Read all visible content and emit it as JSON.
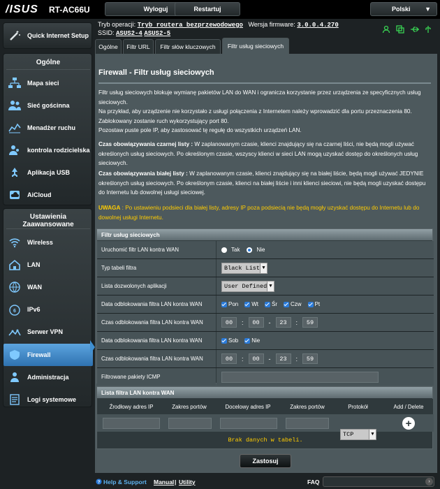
{
  "header": {
    "logo": "/ISUS",
    "model": "RT-AC66U",
    "logout_label": "Wyloguj",
    "restart_label": "Restartuj",
    "language": "Polski"
  },
  "info": {
    "mode_label": "Tryb operacji:",
    "mode_value": "Tryb routera bezprzewodowego",
    "firmware_label": "Wersja firmware:",
    "firmware_value": "3.0.0.4.270",
    "ssid_label": "SSID:",
    "ssid1": "ASUS2-4",
    "ssid2": "ASUS2-5"
  },
  "sidebar": {
    "quick": "Quick Internet Setup",
    "general_heading": "Ogólne",
    "general_items": [
      {
        "label": "Mapa sieci",
        "icon": "network-map-icon"
      },
      {
        "label": "Sieć gościnna",
        "icon": "guest-network-icon"
      },
      {
        "label": "Menadżer ruchu",
        "icon": "traffic-manager-icon"
      },
      {
        "label": "kontrola rodzicielska",
        "icon": "parental-control-icon"
      },
      {
        "label": "Aplikacja USB",
        "icon": "usb-icon"
      },
      {
        "label": "AiCloud",
        "icon": "aicloud-icon"
      }
    ],
    "advanced_heading": "Ustawienia Zaawansowane",
    "advanced_items": [
      {
        "label": "Wireless",
        "icon": "wireless-icon"
      },
      {
        "label": "LAN",
        "icon": "lan-icon"
      },
      {
        "label": "WAN",
        "icon": "wan-icon"
      },
      {
        "label": "IPv6",
        "icon": "ipv6-icon"
      },
      {
        "label": "Serwer VPN",
        "icon": "vpn-icon"
      },
      {
        "label": "Firewall",
        "icon": "firewall-icon",
        "active": true
      },
      {
        "label": "Administracja",
        "icon": "admin-icon"
      },
      {
        "label": "Logi systemowe",
        "icon": "system-log-icon"
      }
    ]
  },
  "tabs": [
    "Ogólne",
    "Filtr URL",
    "Filtr słów kluczowych",
    "Filtr usług sieciowych"
  ],
  "page": {
    "title": "Firewall - Filtr usług sieciowych",
    "p1": "Filtr usług sieciowych blokuje wymianę pakietów LAN do WAN i ogranicza korzystanie przez urządzenia ze specyficznych usług sieciowych.",
    "p2": "Na przykład, aby urządzenie nie korzystało z usługi połączenia z Internetem należy wprowadzić dla portu przeznaczenia 80. Zablokowany zostanie ruch wykorzystujący port 80.",
    "p3": "Pozostaw puste pole IP, aby zastosować tę regułę do wszystkich urządzeń LAN.",
    "black_bold": "Czas obowiązywania czarnej listy :",
    "black_text": " W zaplanowanym czasie, klienci znajdujący się na czarnej liści, nie będą mogli używać określonych usług sieciowych. Po określonym czasie, wszyscy klienci w sieci LAN mogą uzyskać dostęp do określonych usług sieciowych.",
    "white_bold": "Czas obowiązywania białej listy :",
    "white_text": " W zaplanowanym czasie, klienci znajdujący się na białej liście, będą mogli używać JEDYNIE określonych usług sieciowych. Po określonym czasie, klienci na białej liście i inni klienci sieciowi, nie będą mogli uzyskać dostępu do Internetu lub dowolnej usługi sieciowej.",
    "warn_bold": "UWAGA",
    "warn_text": " : Po ustawieniu podsieci dla białej listy, adresy IP poza podsiecią nie będą mogły uzyskać dostępu do Internetu lub do dowolnej usługi Internetu."
  },
  "filter": {
    "heading": "Filtr usług sieciowych",
    "enable_label": "Uruchomić filtr LAN kontra WAN",
    "yes": "Tak",
    "no": "Nie",
    "type_label": "Typ tabeli filtra",
    "type_value": "Black List",
    "apps_label": "Lista dozwolonych aplikacji",
    "apps_value": "User Defined",
    "days1_label": "Data odblokowania filtra LAN kontra WAN",
    "days1": [
      "Pon",
      "Wt",
      "Śr",
      "Czw",
      "Pt"
    ],
    "time1_label": "Czas odblokowania filtra LAN kontra WAN",
    "time1": [
      "00",
      "00",
      "23",
      "59"
    ],
    "days2_label": "Data odblokowania filtra LAN kontra WAN",
    "days2": [
      "Sob",
      "Nie"
    ],
    "time2_label": "Czas odblokowania filtra LAN kontra WAN",
    "time2": [
      "00",
      "00",
      "23",
      "59"
    ],
    "icmp_label": "Filtrowane pakiety ICMP"
  },
  "list": {
    "heading": "Lista filtra LAN kontra WAN",
    "cols": [
      "Źrodłowy adres IP",
      "Zakres portów",
      "Docelowy adres IP",
      "Zakres portów",
      "Protokół",
      "Add / Delete"
    ],
    "protocol": "TCP",
    "empty": "Brak danych w tabeli."
  },
  "apply_label": "Zastosuj",
  "footer": {
    "help": "Help & Support",
    "manual": "Manual",
    "sep": "|",
    "utility": "Utility",
    "faq": "FAQ"
  }
}
